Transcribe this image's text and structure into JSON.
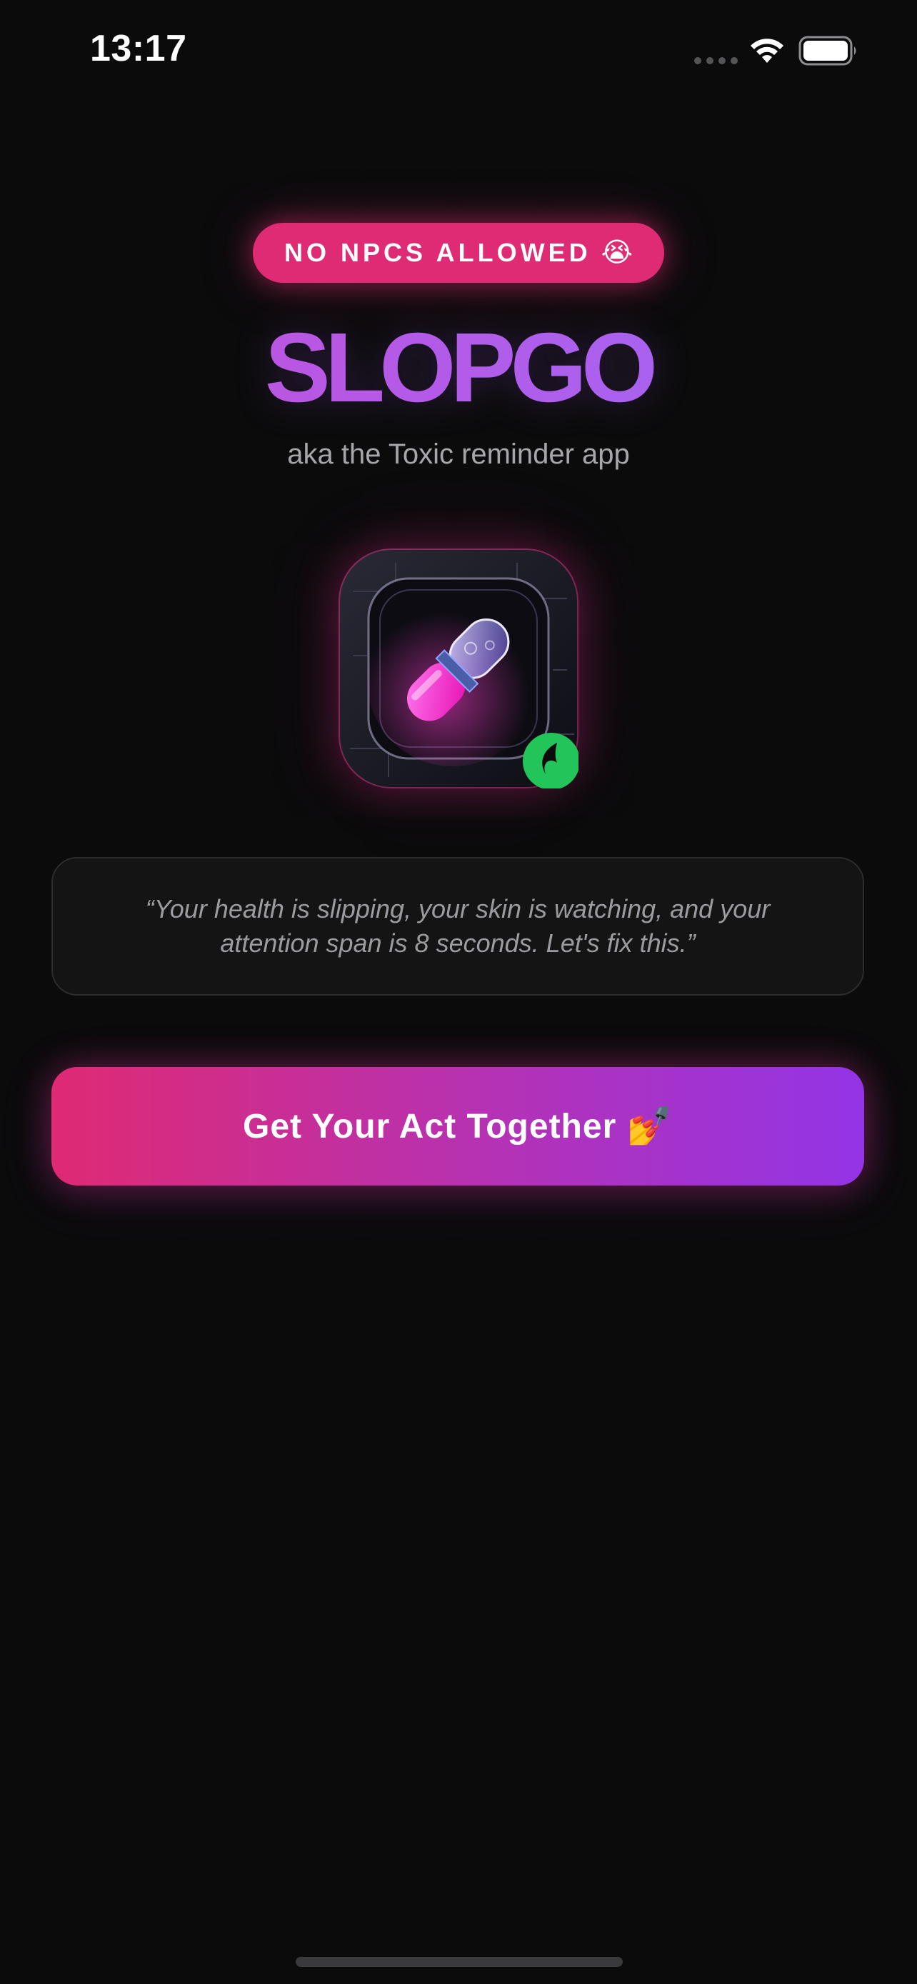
{
  "status_bar": {
    "time": "13:17",
    "wifi_icon": "wifi-icon",
    "battery_icon": "battery-icon"
  },
  "badge": {
    "label": "NO NPCS ALLOWED",
    "emoji": "😭"
  },
  "header": {
    "title": "SLOPGO",
    "subtitle": "aka the Toxic reminder app"
  },
  "app_icon": {
    "name": "pill-app-icon",
    "overlay_icon": "leaf-badge-icon"
  },
  "quote": {
    "text": "“Your health is slipping, your skin is watching, and your attention span is 8 seconds. Let's fix this.”"
  },
  "cta": {
    "label": "Get Your Act Together",
    "emoji": "💅"
  },
  "colors": {
    "background": "#0b0b0c",
    "badge": "#df2a74",
    "title_gradient_start": "#c44fd6",
    "title_gradient_end": "#9d6cf6",
    "cta_gradient_start": "#df2a74",
    "cta_gradient_end": "#9334e6",
    "leaf_badge": "#23c45a"
  }
}
